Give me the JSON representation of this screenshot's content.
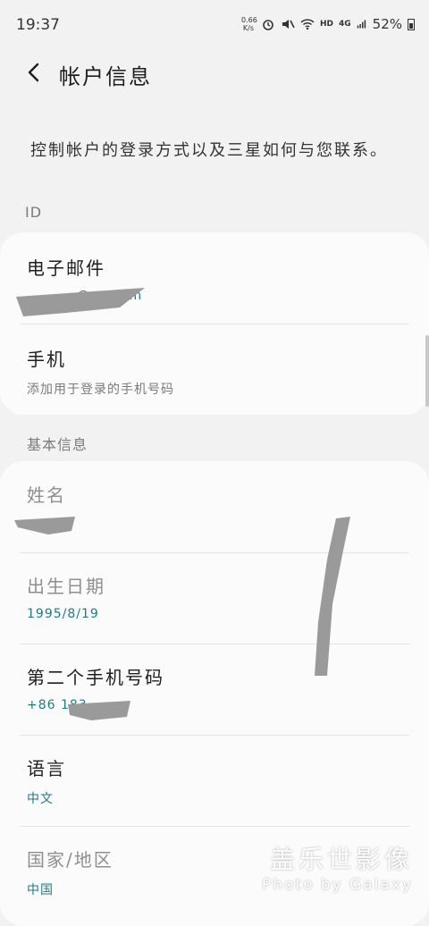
{
  "status": {
    "time": "19:37",
    "net_speed_value": "0.66",
    "net_speed_unit": "K/s",
    "hd": "HD",
    "signal": "4G",
    "battery": "52%"
  },
  "header": {
    "title": "帐户信息"
  },
  "description": "控制帐户的登录方式以及三星如何与您联系。",
  "sections": {
    "id_label": "ID",
    "basic_label": "基本信息"
  },
  "account": {
    "email_label": "电子邮件",
    "email_value": "@qq.com",
    "phone_label": "手机",
    "phone_value": "添加用于登录的手机号码"
  },
  "basic": {
    "name_label": "姓名",
    "birth_label": "出生日期",
    "birth_value": "1995/8/19",
    "second_phone_label": "第二个手机号码",
    "second_phone_value": "+86 183",
    "language_label": "语言",
    "language_value": "中文",
    "region_label": "国家/地区",
    "region_value": "中国"
  },
  "watermark": {
    "line1": "盖乐世影像",
    "line2": "Photo by Galaxy"
  }
}
